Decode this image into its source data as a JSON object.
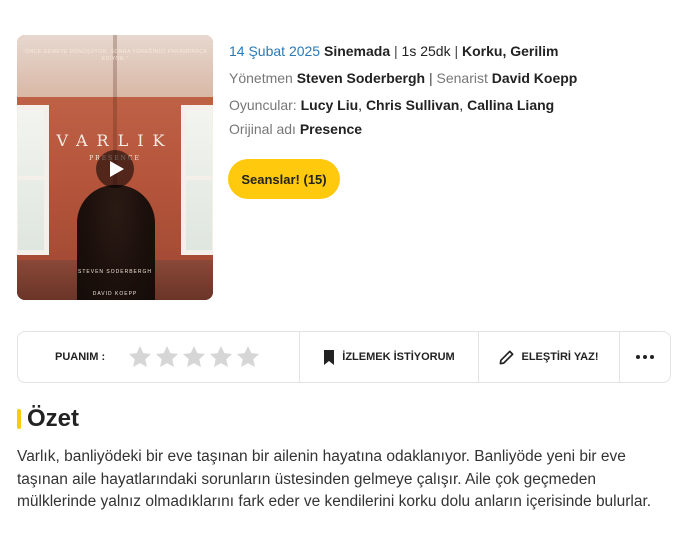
{
  "poster": {
    "tagline": "\"ÖNCE GEMEYE DÖNÜŞÜYOR. SONRA YÜREĞİNİZİ PARAMPARÇA EDİYOR.\"",
    "title": "VARLIK",
    "subtitle": "PRESENCE",
    "director_credit": "STEVEN SODERBERGH",
    "writer_credit": "DAVID KOEPP"
  },
  "movie": {
    "release_date": "14 Şubat 2025",
    "release_status": "Sinemada",
    "duration": "1s 25dk",
    "genre_1": "Korku",
    "genre_2": "Gerilim",
    "director_label": "Yönetmen",
    "director": "Steven Soderbergh",
    "writer_label": "Senarist",
    "writer": "David Koepp",
    "cast_label": "Oyuncular:",
    "cast_1": "Lucy Liu",
    "cast_2": "Chris Sullivan",
    "cast_3": "Callina Liang",
    "original_label": "Orijinal adı",
    "original_title": "Presence"
  },
  "sessions_button": "Seanslar! (15)",
  "action_bar": {
    "rating_label": "PUANIM :",
    "rating_value": 0,
    "rating_max": 5,
    "watchlist_label": "İZLEMEK İSTİYORUM",
    "review_label": "ELEŞTİRİ YAZ!"
  },
  "summary": {
    "title": "Özet",
    "text": "Varlık, banliyödeki bir eve taşınan bir ailenin hayatına odaklanıyor. Banliyöde yeni bir eve taşınan aile hayatlarındaki sorunların üstesinden gelmeye çalışır. Aile çok geçmeden mülklerinde yalnız olmadıklarını fark eder ve kendilerini korku dolu anların içerisinde bulurlar."
  },
  "colors": {
    "accent": "#ffc90e",
    "date_blue": "#2a7ab8",
    "star_empty": "#d6d6d6"
  },
  "icons": {
    "play": "play-icon",
    "bookmark": "bookmark-icon",
    "pen": "pen-icon",
    "more": "more-dots-icon",
    "star": "star-icon"
  }
}
